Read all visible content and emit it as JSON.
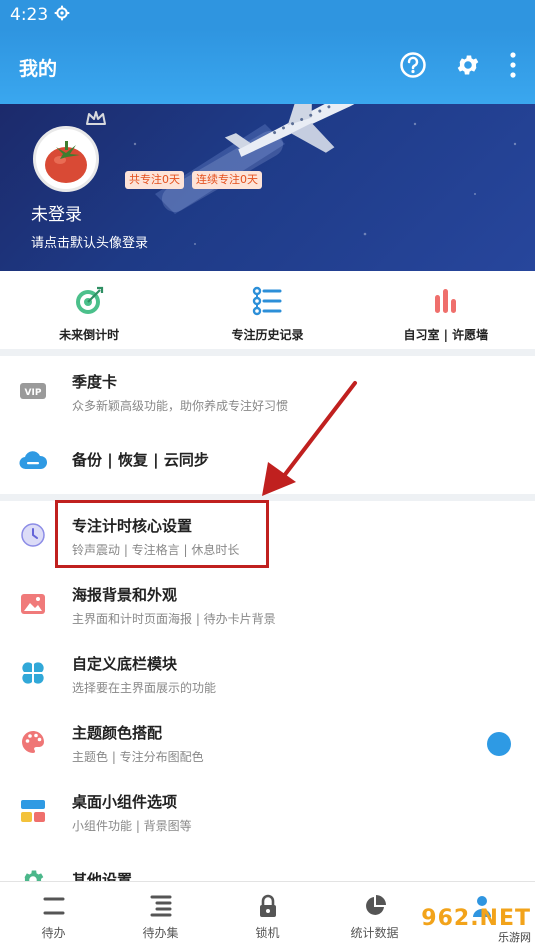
{
  "status_bar": {
    "time": "4:23",
    "settings_icon": "gear-small-icon"
  },
  "app_bar": {
    "title": "我的",
    "icons": [
      "help-circle-icon",
      "gear-icon",
      "more-vertical-icon"
    ]
  },
  "profile": {
    "total_focus": "共专注0天",
    "streak_focus": "连续专注0天",
    "login_status": "未登录",
    "login_hint": "请点击默认头像登录"
  },
  "shortcuts": [
    {
      "label": "未来倒计时",
      "icon": "target-icon"
    },
    {
      "label": "专注历史记录",
      "icon": "history-list-icon"
    },
    {
      "label": "自习室 | 许愿墙",
      "icon": "bar-chart-icon"
    }
  ],
  "menu": [
    {
      "title": "季度卡",
      "subtitle": "众多新颖高级功能，助你养成专注好习惯",
      "icon": "vip-icon"
    },
    {
      "title": "备份 | 恢复 | 云同步",
      "subtitle": "",
      "icon": "cloud-icon"
    },
    {
      "title": "专注计时核心设置",
      "subtitle": "铃声震动 | 专注格言 | 休息时长",
      "icon": "clock-icon"
    },
    {
      "title": "海报背景和外观",
      "subtitle": "主界面和计时页面海报 | 待办卡片背景",
      "icon": "image-icon"
    },
    {
      "title": "自定义底栏模块",
      "subtitle": "选择要在主界面展示的功能",
      "icon": "clover-icon"
    },
    {
      "title": "主题颜色搭配",
      "subtitle": "主题色 | 专注分布图配色",
      "icon": "palette-icon"
    },
    {
      "title": "桌面小组件选项",
      "subtitle": "小组件功能 | 背景图等",
      "icon": "widget-icon"
    },
    {
      "title": "其他设置",
      "subtitle": "",
      "icon": "gear-green-icon"
    }
  ],
  "bottom_nav": [
    {
      "label": "待办",
      "icon": "todo-icon"
    },
    {
      "label": "待办集",
      "icon": "todo-set-icon"
    },
    {
      "label": "锁机",
      "icon": "lock-icon"
    },
    {
      "label": "统计数据",
      "icon": "pie-chart-icon"
    },
    {
      "label": "",
      "icon": "profile-icon"
    }
  ],
  "watermark": {
    "brand": "962.NET",
    "caption": "乐游网"
  },
  "colors": {
    "primary": "#2f95e0",
    "highlight": "#c0201f",
    "badge_text": "#e4501e"
  }
}
